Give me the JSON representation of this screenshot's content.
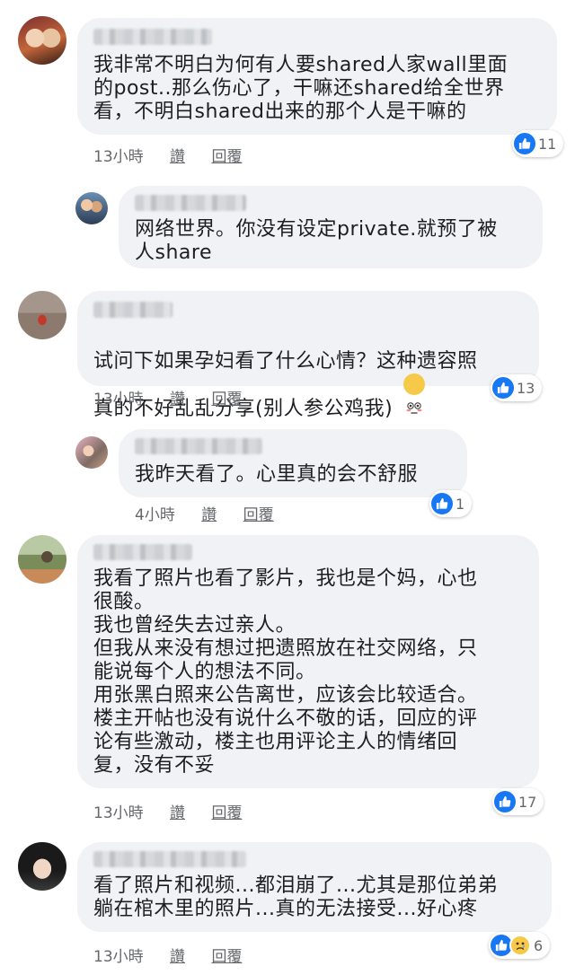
{
  "comments": [
    {
      "text": "我非常不明白为何有人要shared人家wall里面\n的post..那么伤心了，干嘛还shared给全世界\n看，不明白shared出来的那个人是干嘛的",
      "time": "13小時",
      "like_label": "讚",
      "reply_label": "回覆",
      "reactions": "11"
    },
    {
      "text": "网络世界。你没有设定private.就预了被\n人share"
    },
    {
      "text": "试问下如果孕妇看了什么心情？这种遗容照\n真的不好乱乱分享(别人参公鸡我)",
      "emoji": "flushed-face-emoji",
      "time": "13小時",
      "like_label": "讚",
      "reply_label": "回覆",
      "reactions": "13"
    },
    {
      "text": "我昨天看了。心里真的会不舒服",
      "time": "4小時",
      "like_label": "讚",
      "reply_label": "回覆",
      "reactions": "1"
    },
    {
      "text": "我看了照片也看了影片，我也是个妈，心也\n很酸。\n我也曾经失去过亲人。\n但我从来没有想过把遗照放在社交网络，只\n能说每个人的想法不同。\n用张黑白照来公告离世，应该会比较适合。\n楼主开帖也没有说什么不敬的话，回应的评\n论有些激动，楼主也用评论主人的情绪回\n复，没有不妥",
      "time": "13小時",
      "like_label": "讚",
      "reply_label": "回覆",
      "reactions": "17"
    },
    {
      "text": "看了照片和视频...都泪崩了...尤其是那位弟弟\n躺在棺木里的照片...真的无法接受...好心疼",
      "time": "13小時",
      "like_label": "讚",
      "reply_label": "回覆",
      "reactions": "6"
    }
  ],
  "colors": {
    "like_blue": "#1877f2",
    "bubble_bg": "#f0f2f5",
    "meta_gray": "#65676b"
  },
  "icons": {
    "like": "thumbs-up-icon",
    "sad": "sad-face-icon"
  }
}
